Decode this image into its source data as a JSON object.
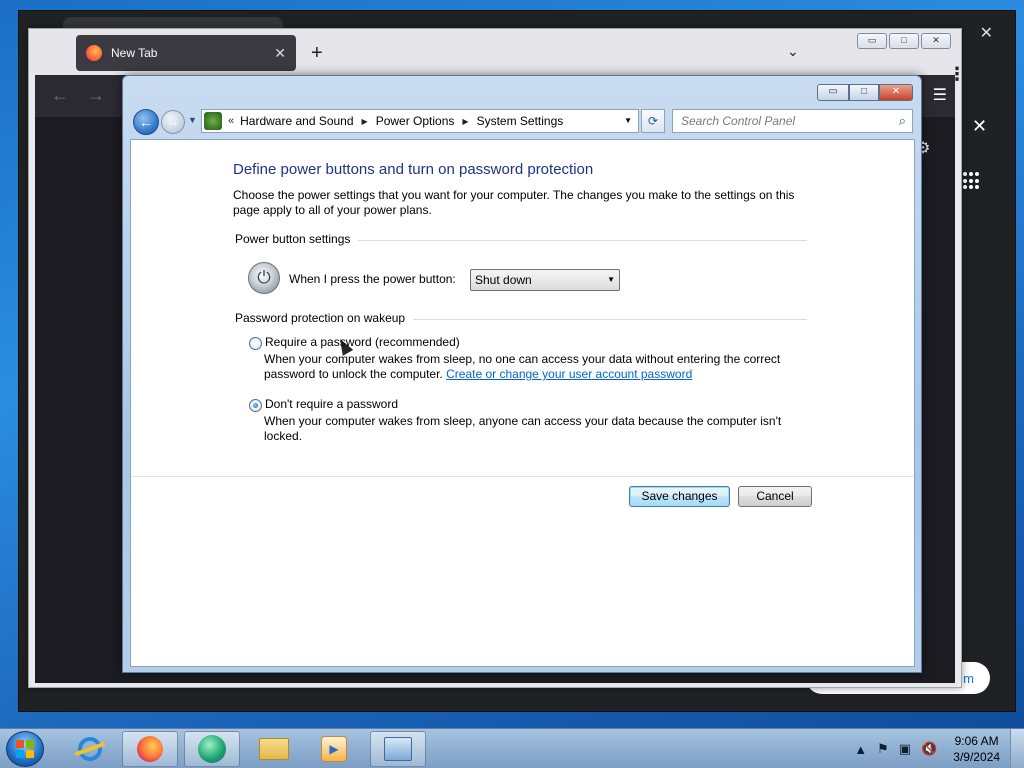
{
  "background_window": {
    "close_glyph": "✕",
    "side_close_glyph": "✕",
    "pill_text": "m"
  },
  "firefox": {
    "tab_label": "New Tab",
    "tab_close": "✕",
    "new_tab": "+",
    "list_tabs": "⌄",
    "caption": {
      "minimize": "▭",
      "maximize": "□",
      "close": "✕"
    },
    "nav": {
      "back": "←",
      "forward": "→",
      "menu": "☰",
      "kebab": "⋮",
      "gear": "⚙"
    }
  },
  "control_panel": {
    "caption": {
      "minimize": "▭",
      "maximize": "□",
      "close": "✕"
    },
    "nav": {
      "back": "←",
      "forward": "→",
      "recent": "▼"
    },
    "address": {
      "chevrons": "«",
      "breadcrumbs": [
        "Hardware and Sound",
        "Power Options",
        "System Settings"
      ],
      "separator": "▶",
      "dropdown": "▼"
    },
    "refresh": "⟳",
    "search": {
      "placeholder": "Search Control Panel",
      "icon": "search-icon"
    },
    "title": "Define power buttons and turn on password protection",
    "description": "Choose the power settings that you want for your computer. The changes you make to the settings on this page apply to all of your power plans.",
    "power_section": {
      "heading": "Power button settings",
      "label": "When I press the power button:",
      "selected": "Shut down",
      "icon": "power-icon"
    },
    "password_section": {
      "heading": "Password protection on wakeup",
      "options": [
        {
          "label": "Require a password (recommended)",
          "checked": false,
          "description": "When your computer wakes from sleep, no one can access your data without entering the correct password to unlock the computer.",
          "link": "Create or change your user account password"
        },
        {
          "label": "Don't require a password",
          "checked": true,
          "description": "When your computer wakes from sleep, anyone can access your data because the computer isn't locked."
        }
      ]
    },
    "buttons": {
      "save": "Save changes",
      "cancel": "Cancel"
    }
  },
  "taskbar": {
    "apps": [
      "internet-explorer",
      "firefox",
      "edge",
      "file-explorer",
      "media-player",
      "control-panel"
    ],
    "tray": {
      "show_hidden": "▲",
      "flag": "⚑",
      "network": "▣",
      "volume": "🔇"
    },
    "time": "9:06 AM",
    "date": "3/9/2024"
  }
}
